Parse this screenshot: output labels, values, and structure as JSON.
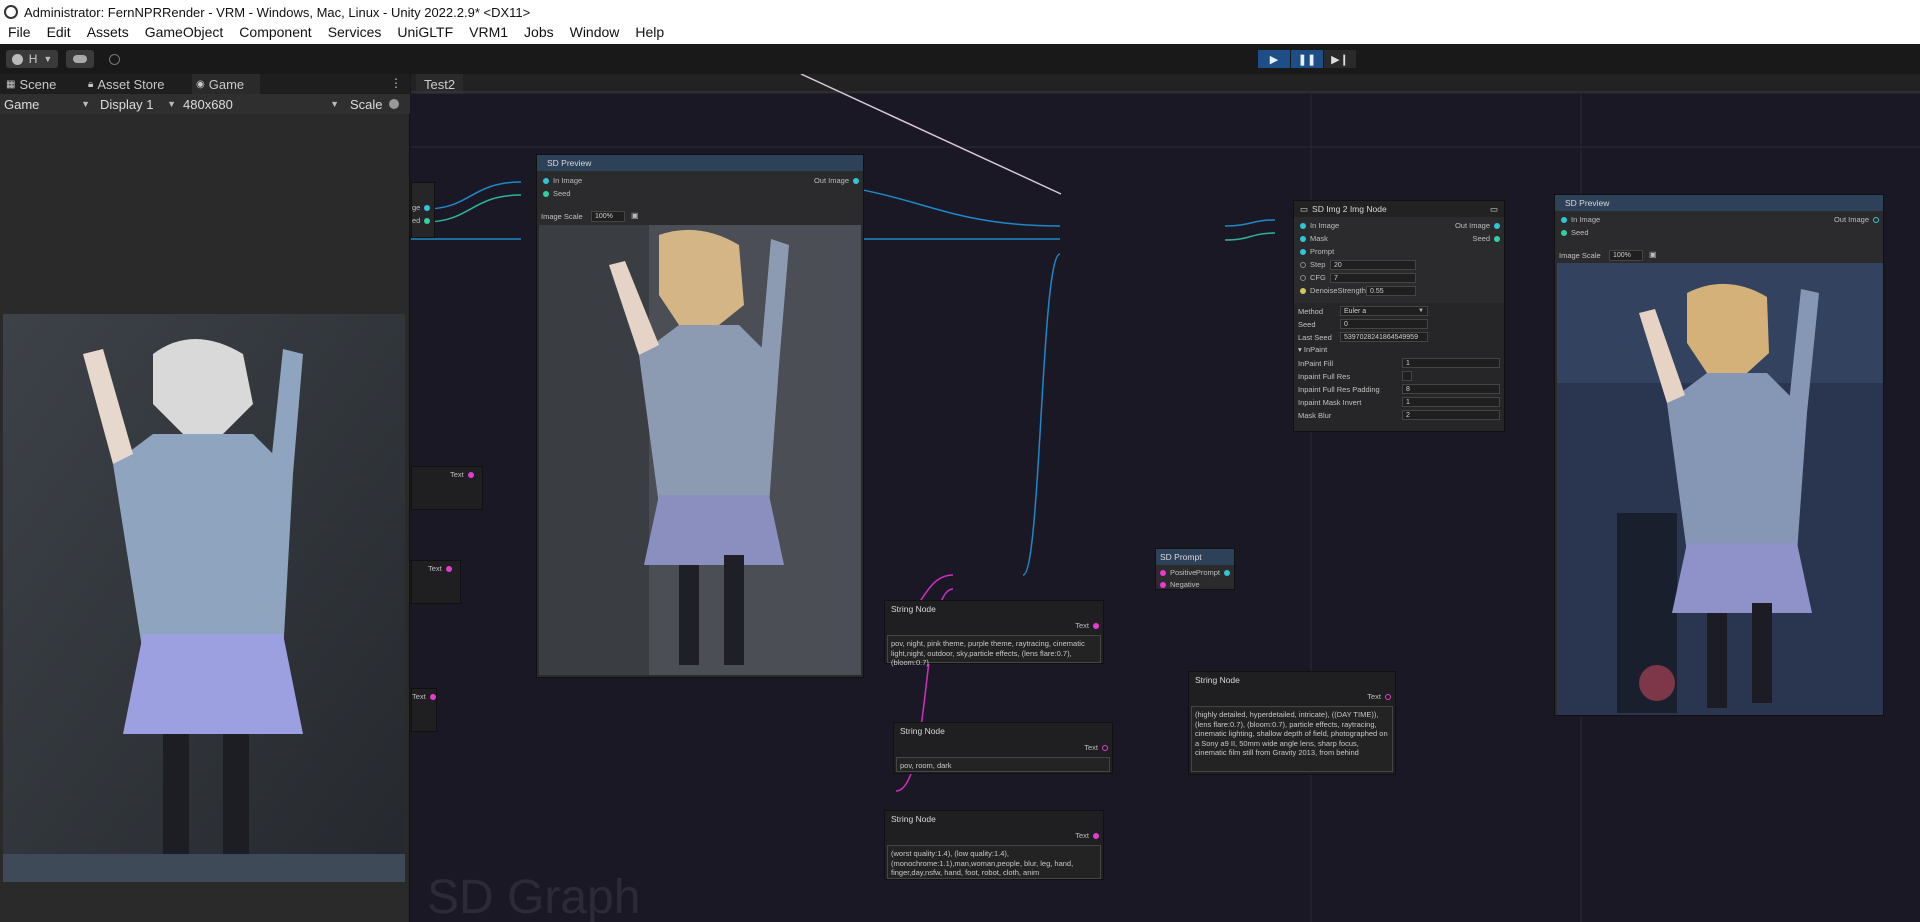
{
  "window": {
    "title": "Administrator: FernNPRRender - VRM - Windows, Mac, Linux - Unity 2022.2.9* <DX11>"
  },
  "menu": [
    "File",
    "Edit",
    "Assets",
    "GameObject",
    "Component",
    "Services",
    "UniGLTF",
    "VRM1",
    "Jobs",
    "Window",
    "Help"
  ],
  "toolbar": {
    "account_label": "H",
    "play": "▶",
    "pause": "❚❚",
    "step": "▶❙"
  },
  "left_tabs": [
    {
      "label": "Scene",
      "icon": "grid-icon"
    },
    {
      "label": "Asset Store",
      "icon": "lock-icon"
    },
    {
      "label": "Game",
      "icon": "gamepad-icon"
    }
  ],
  "game_bar": {
    "mode": "Game",
    "display": "Display 1",
    "resolution": "480x680",
    "scale": "Scale"
  },
  "graph": {
    "tab": "Test2",
    "watermark": "SD Graph"
  },
  "preview1": {
    "title": "SD Preview",
    "in_image": "In Image",
    "seed": "Seed",
    "out_image": "Out Image",
    "scale_label": "Image Scale",
    "scale_value": "100%"
  },
  "img2img": {
    "title": "SD Img 2 Img Node",
    "inputs": [
      "In Image",
      "Mask",
      "Prompt",
      "Step",
      "CFG",
      "DenoiseStrength"
    ],
    "step_value": "20",
    "cfg_value": "7",
    "denoise_value": "0.55",
    "out_image": "Out Image",
    "seed_out": "Seed",
    "method_label": "Method",
    "method_value": "Euler a",
    "seed_label": "Seed",
    "seed_value": "0",
    "last_seed_label": "Last Seed",
    "last_seed_value": "5397028241864549959",
    "inpaint_header": "InPaint",
    "inpaint_rows": [
      {
        "label": "InPaint Fill",
        "value": "1"
      },
      {
        "label": "Inpaint Full Res",
        "value": ""
      },
      {
        "label": "Inpaint Full Res Padding",
        "value": "8"
      },
      {
        "label": "Inpaint Mask Invert",
        "value": "1"
      },
      {
        "label": "Mask Blur",
        "value": "2"
      }
    ]
  },
  "preview2": {
    "title": "SD Preview",
    "in_image": "In Image",
    "seed": "Seed",
    "out_image": "Out Image",
    "scale_label": "Image Scale",
    "scale_value": "100%"
  },
  "prompt_node": {
    "title": "SD Prompt",
    "positive": "Positive",
    "negative": "Negative",
    "prompt_out": "Prompt"
  },
  "string_nodes": [
    {
      "title": "String Node",
      "port": "Text",
      "text": "pov, night, pink theme, purple theme, raytracing, cinematic light,night, outdoor, sky,particle effects, (lens flare:0.7), (bloom:0.7)"
    },
    {
      "title": "String Node",
      "port": "Text",
      "text": "pov, room, dark"
    },
    {
      "title": "String Node",
      "port": "Text",
      "text": "(worst quality:1.4), (low quality:1.4), (monochrome:1.1),man,woman,people, blur, leg, hand, finger,day,nsfw, hand, foot, robot, cloth, anim"
    },
    {
      "title": "String Node",
      "port": "Text",
      "text": "(highly detailed, hyperdetailed, intricate), ((DAY TIME)), (lens flare:0.7), (bloom:0.7), particle effects, raytracing, cinematic lighting, shallow depth of field, photographed on a Sony a9 II, 50mm wide angle lens, sharp focus, cinematic film still from Gravity 2013, from behind"
    }
  ],
  "left_stub_text": [
    "Text",
    "Text",
    "Text"
  ],
  "left_stub_ports": [
    "ge",
    "ed"
  ]
}
